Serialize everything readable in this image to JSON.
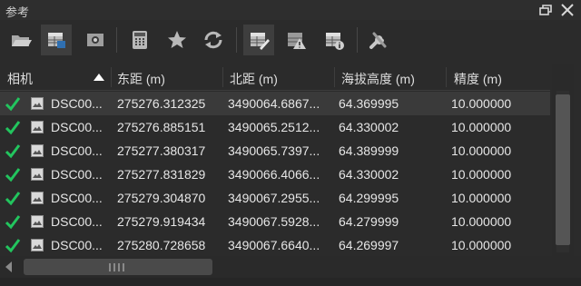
{
  "window": {
    "title": "参考"
  },
  "toolbar": {
    "buttons": [
      {
        "name": "open-folder-icon"
      },
      {
        "name": "image-table-icon",
        "active": true
      },
      {
        "name": "camera-icon"
      },
      {
        "name": "calculator-icon"
      },
      {
        "name": "star-icon"
      },
      {
        "name": "refresh-icon"
      },
      {
        "name": "edit-table-icon",
        "active": true
      },
      {
        "name": "warning-icon"
      },
      {
        "name": "info-table-icon"
      },
      {
        "name": "tools-icon"
      }
    ]
  },
  "table": {
    "columns": [
      "相机",
      "东距 (m)",
      "北距 (m)",
      "海拔高度 (m)",
      "精度 (m)"
    ],
    "sort_column": "相机",
    "rows": [
      {
        "camera": "DSC00...",
        "easting": "275276.312325",
        "northing": "3490064.6867...",
        "altitude": "64.369995",
        "accuracy": "10.000000",
        "checked": true
      },
      {
        "camera": "DSC00...",
        "easting": "275276.885151",
        "northing": "3490065.2512...",
        "altitude": "64.330002",
        "accuracy": "10.000000",
        "checked": true
      },
      {
        "camera": "DSC00...",
        "easting": "275277.380317",
        "northing": "3490065.7397...",
        "altitude": "64.389999",
        "accuracy": "10.000000",
        "checked": true
      },
      {
        "camera": "DSC00...",
        "easting": "275277.831829",
        "northing": "3490066.4066...",
        "altitude": "64.330002",
        "accuracy": "10.000000",
        "checked": true
      },
      {
        "camera": "DSC00...",
        "easting": "275279.304870",
        "northing": "3490067.2955...",
        "altitude": "64.299995",
        "accuracy": "10.000000",
        "checked": true
      },
      {
        "camera": "DSC00...",
        "easting": "275279.919434",
        "northing": "3490067.5928...",
        "altitude": "64.279999",
        "accuracy": "10.000000",
        "checked": true
      },
      {
        "camera": "DSC00...",
        "easting": "275280.728658",
        "northing": "3490067.6640...",
        "altitude": "64.269997",
        "accuracy": "10.000000",
        "checked": true
      }
    ]
  },
  "colors": {
    "check": "#22c55e",
    "background": "#2b2b2b",
    "selected_row": "#3a3a3a"
  }
}
